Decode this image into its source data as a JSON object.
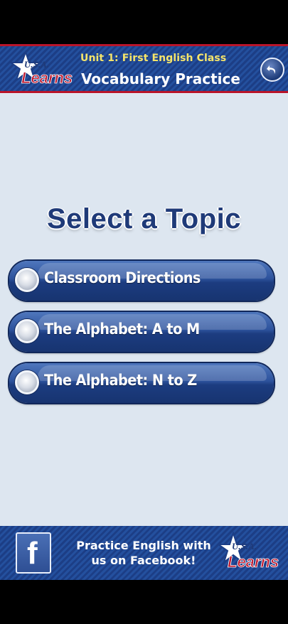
{
  "header": {
    "logo_text_top": "U.S.A.",
    "logo_text_main": "Learns",
    "unit": "Unit 1: First English Class",
    "title": "Vocabulary Practice",
    "back_icon": "back-arrow-icon"
  },
  "main": {
    "heading": "Select a Topic",
    "topics": [
      {
        "label": "Classroom Directions"
      },
      {
        "label": "The Alphabet: A to M"
      },
      {
        "label": "The Alphabet: N to Z"
      }
    ]
  },
  "footer": {
    "facebook_icon": "facebook-icon",
    "facebook_letter": "f",
    "line1": "Practice English with",
    "line2": "us on Facebook!",
    "logo_text_top": "U.S.A.",
    "logo_text_main": "Learns"
  },
  "colors": {
    "brand_blue": "#1f3a78",
    "accent_red": "#b8152a",
    "accent_yellow": "#f6e56a",
    "background": "#dde6f0"
  }
}
